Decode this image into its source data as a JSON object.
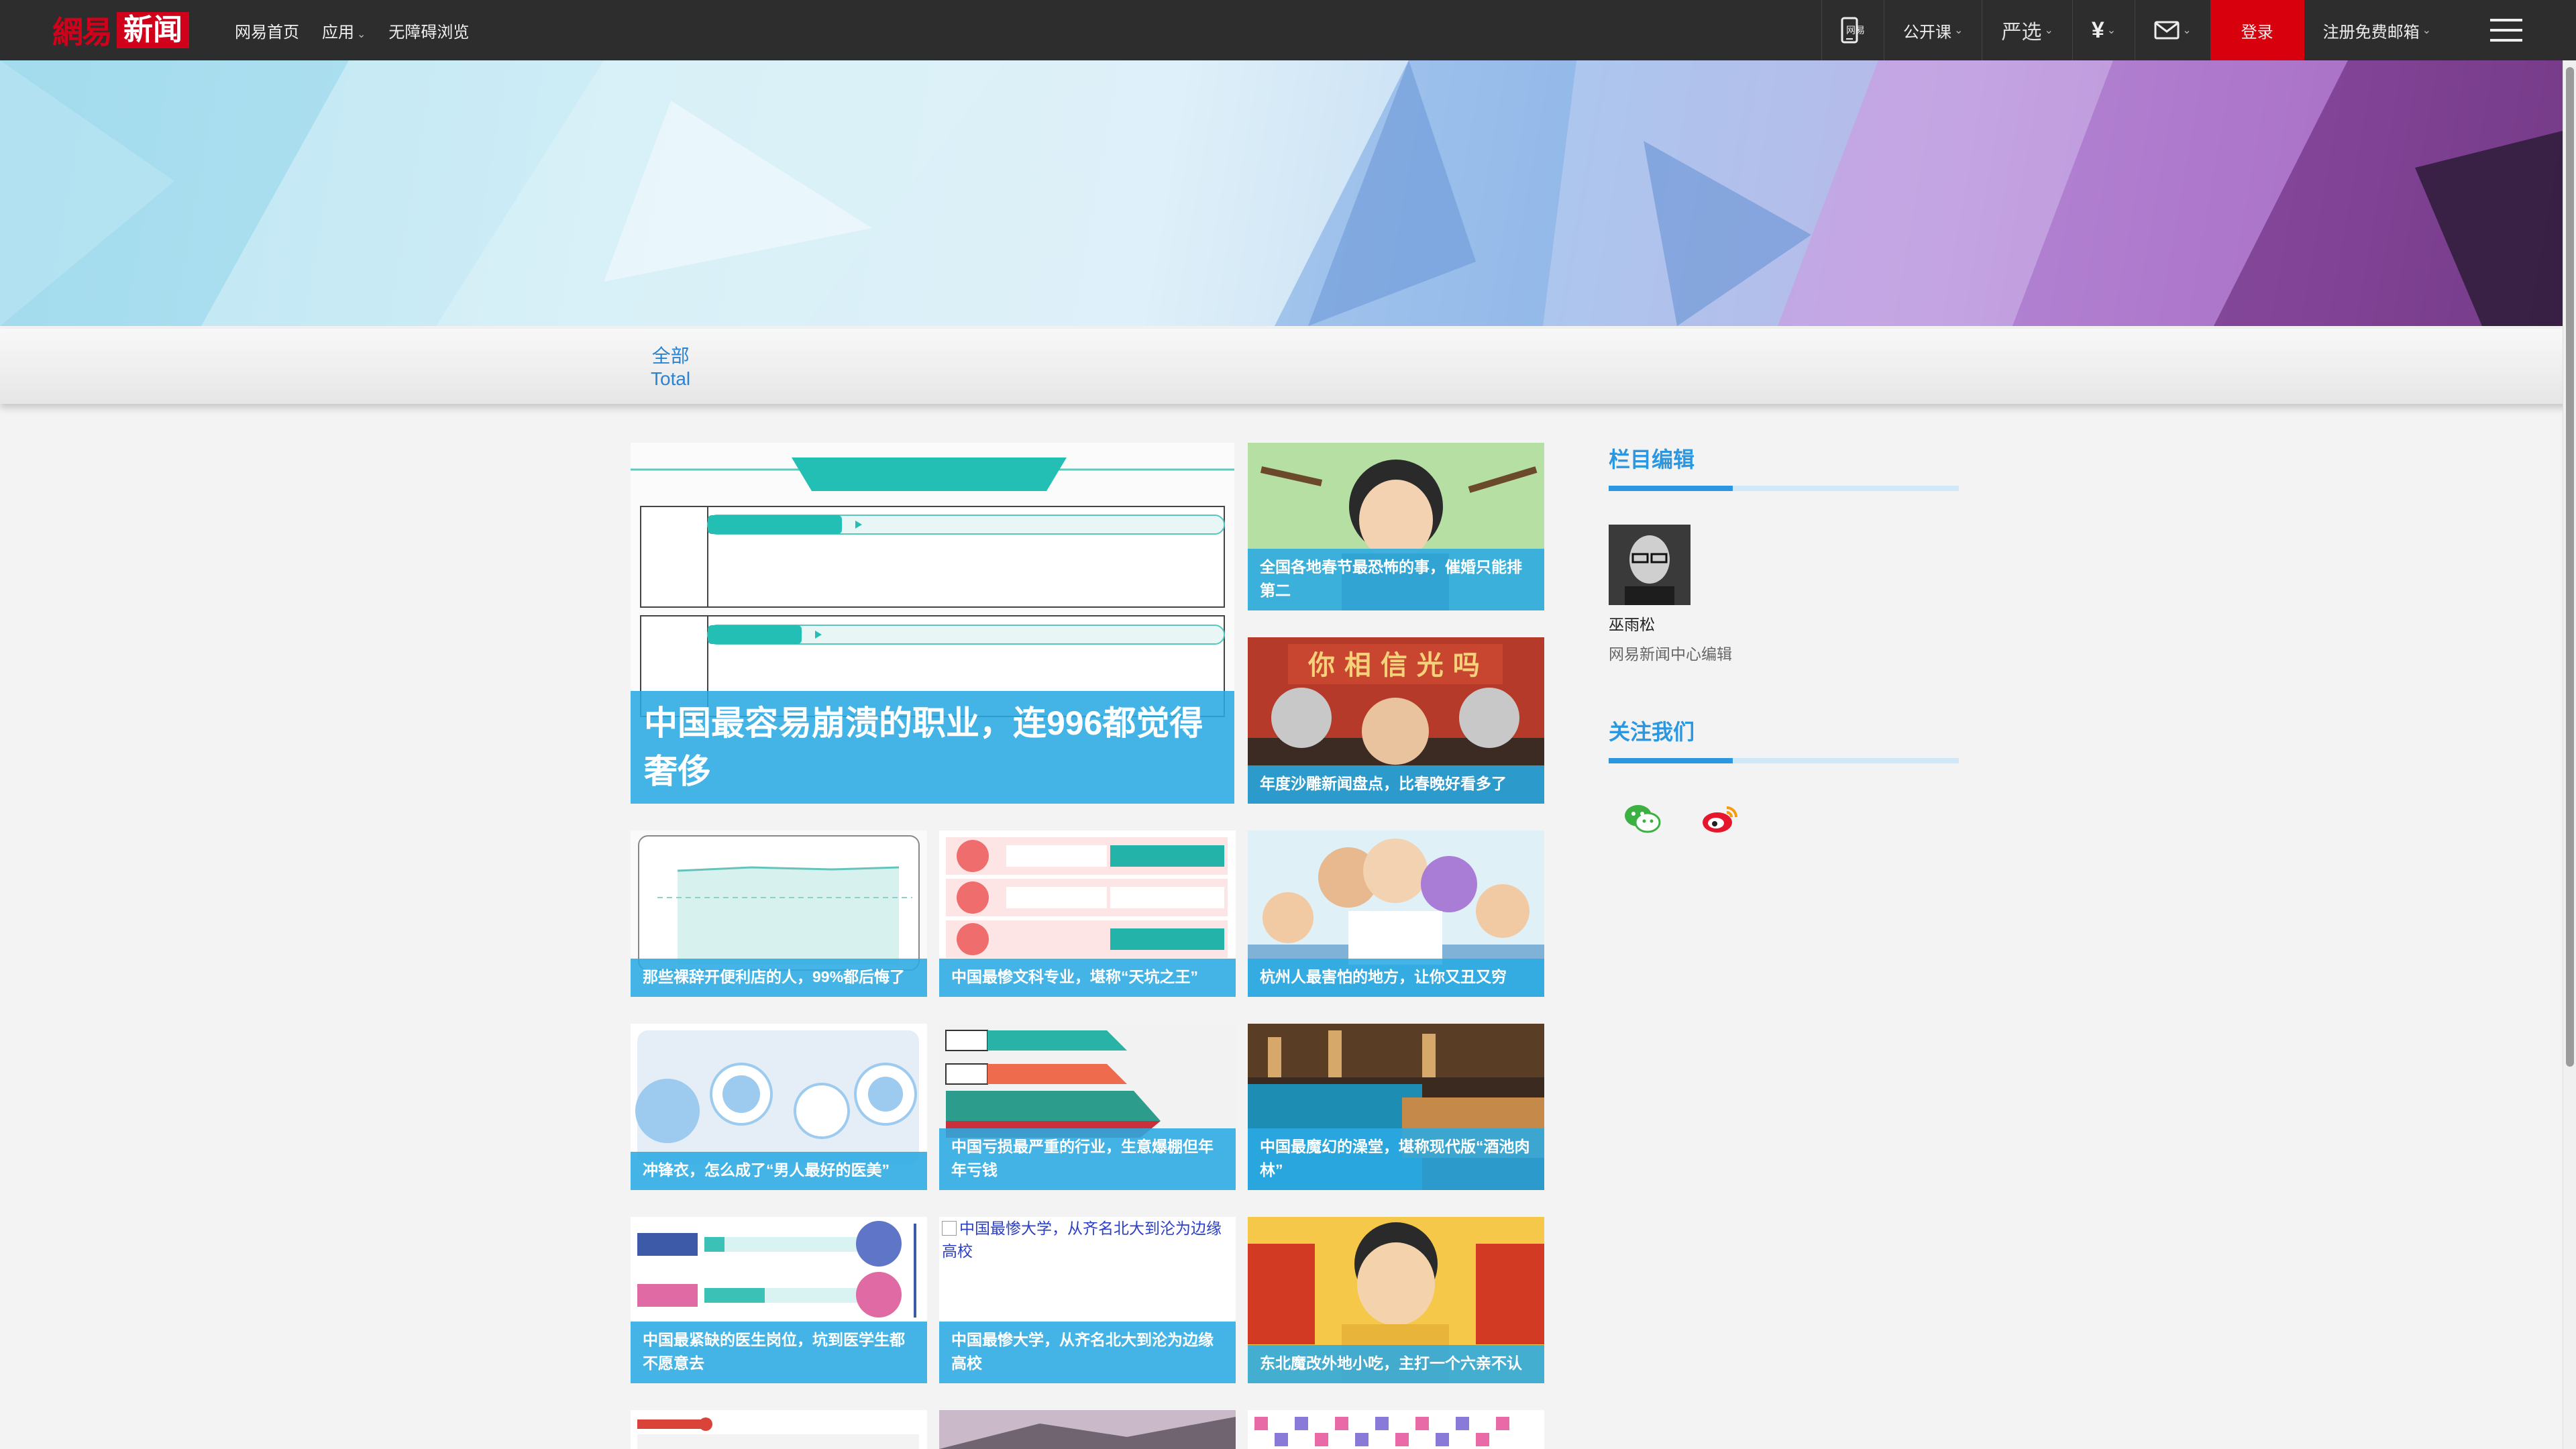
{
  "nav": {
    "logo_part1": "網易",
    "logo_part2": "新闻",
    "links": [
      "网易首页",
      "应用",
      "无障碍浏览"
    ],
    "app_label": "应用",
    "right": {
      "mobile_label": "网易",
      "course": "公开课",
      "yanxuan": "严选",
      "login": "登录",
      "register": "注册免费邮箱"
    }
  },
  "filter": {
    "tab_cn": "全部",
    "tab_en": "Total"
  },
  "cards": [
    {
      "caption": "中国最容易崩溃的职业，连996都觉得奢侈"
    },
    {
      "caption": "全国各地春节最恐怖的事，催婚只能排第二"
    },
    {
      "caption": "年度沙雕新闻盘点，比春晚好看多了"
    },
    {
      "caption": "那些裸辞开便利店的人，99%都后悔了"
    },
    {
      "caption": "中国最惨文科专业，堪称“天坑之王”"
    },
    {
      "caption": "杭州人最害怕的地方，让你又丑又穷"
    },
    {
      "caption": "冲锋衣，怎么成了“男人最好的医美”"
    },
    {
      "caption": "中国亏损最严重的行业，生意爆棚但年年亏钱"
    },
    {
      "caption": "中国最魔幻的澡堂，堪称现代版“酒池肉林”"
    },
    {
      "caption": "中国最紧缺的医生岗位，坑到医学生都不愿意去"
    },
    {
      "caption": "中国最惨大学，从齐名北大到沦为边缘高校",
      "alt": "中国最惨大学，从齐名北大到沦为边缘高校"
    },
    {
      "caption": "东北魔改外地小吃，主打一个六亲不认"
    }
  ],
  "sidebar": {
    "editor_title": "栏目编辑",
    "editor_name": "巫雨松",
    "editor_role": "网易新闻中心编辑",
    "follow_title": "关注我们",
    "social_icons": [
      "wechat-icon",
      "weibo-icon"
    ]
  },
  "colors": {
    "accent": "#2a97e0",
    "caption_bg": "#2aaae2",
    "brand_red": "#d9000d",
    "topbar": "#2d2d2d"
  }
}
